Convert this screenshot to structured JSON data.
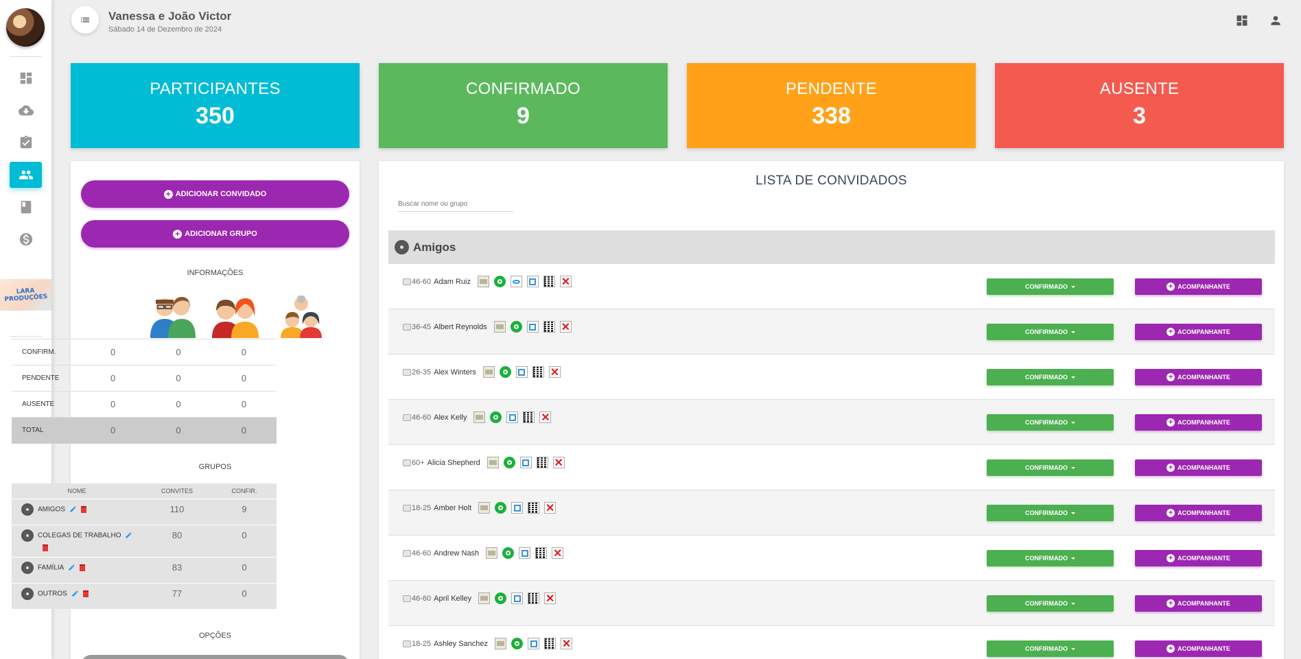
{
  "header": {
    "title": "Vanessa e João Victor",
    "date": "Sábado 14 de Dezembro de 2024",
    "menu_icon": "list-icon",
    "dashboard_icon": "dashboard-icon",
    "user_icon": "person-icon"
  },
  "sidebar": {
    "items": [
      {
        "icon": "dashboard-icon"
      },
      {
        "icon": "cloud-download-icon"
      },
      {
        "icon": "assignment-check-icon"
      },
      {
        "icon": "people-icon",
        "active": true
      },
      {
        "icon": "book-icon"
      },
      {
        "icon": "money-icon"
      }
    ],
    "logo_text": "LARA PRODUÇÕES"
  },
  "stats": [
    {
      "label": "PARTICIPANTES",
      "value": "350",
      "color": "#00bcd4"
    },
    {
      "label": "CONFIRMADO",
      "value": "9",
      "color": "#5cb85c"
    },
    {
      "label": "PENDENTE",
      "value": "338",
      "color": "#ffa21a"
    },
    {
      "label": "AUSENTE",
      "value": "3",
      "color": "#f55a4e"
    }
  ],
  "left": {
    "add_guest": "ADICIONAR CONVIDADO",
    "add_group": "ADICIONAR GRUPO",
    "info_title": "INFORMAÇÕES",
    "info_rows": [
      {
        "label": "CONFIRM.",
        "a": "0",
        "b": "0",
        "c": "0"
      },
      {
        "label": "PENDENTE",
        "a": "0",
        "b": "0",
        "c": "0"
      },
      {
        "label": "AUSENTE",
        "a": "0",
        "b": "0",
        "c": "0"
      },
      {
        "label": "TOTAL",
        "a": "0",
        "b": "0",
        "c": "0"
      }
    ],
    "groups_title": "GRUPOS",
    "groups_headers": {
      "name": "NOME",
      "invites": "CONVITES",
      "confirmed": "CONFIR."
    },
    "groups": [
      {
        "name": "AMIGOS",
        "invites": "110",
        "confirmed": "9"
      },
      {
        "name": "COLEGAS DE TRABALHO",
        "invites": "80",
        "confirmed": "0"
      },
      {
        "name": "FAMÍLIA",
        "invites": "83",
        "confirmed": "0"
      },
      {
        "name": "OUTROS",
        "invites": "77",
        "confirmed": "0"
      }
    ],
    "options_title": "OPÇÕES"
  },
  "main": {
    "title": "LISTA DE CONVIDADOS",
    "search_placeholder": "Buscar nome ou grupo",
    "group_name": "Amigos",
    "confirm_label": "CONFIRMADO",
    "companion_label": "ACOMPANHANTE",
    "guests": [
      {
        "age": "46-60",
        "name": "Adam Ruiz",
        "eye": true
      },
      {
        "age": "36-45",
        "name": "Albert Reynolds",
        "eye": false
      },
      {
        "age": "26-35",
        "name": "Alex Winters",
        "eye": false
      },
      {
        "age": "46-60",
        "name": "Alex Kelly",
        "eye": false
      },
      {
        "age": "60+",
        "name": "Alicia Shepherd",
        "eye": false
      },
      {
        "age": "18-25",
        "name": "Amber Holt",
        "eye": false
      },
      {
        "age": "46-60",
        "name": "Andrew Nash",
        "eye": false
      },
      {
        "age": "46-60",
        "name": "April Kelley",
        "eye": false
      },
      {
        "age": "18-25",
        "name": "Ashley Sanchez",
        "eye": false
      }
    ]
  }
}
